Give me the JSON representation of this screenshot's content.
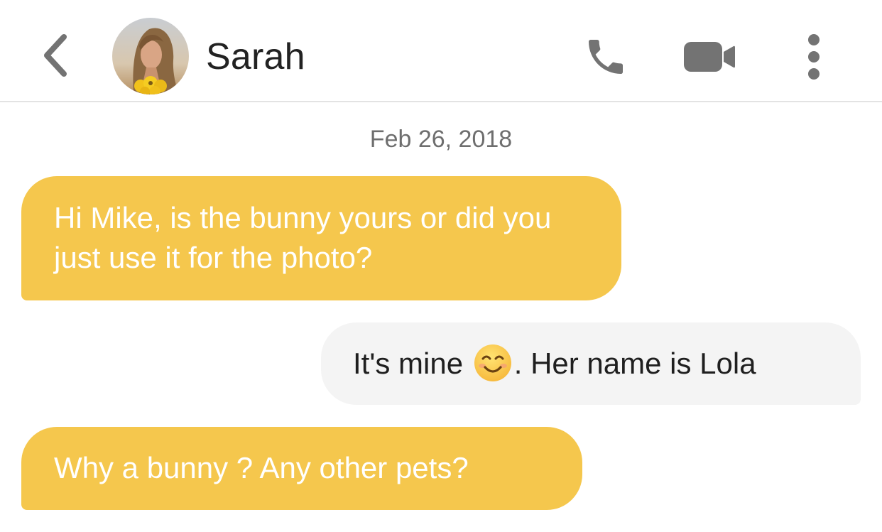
{
  "header": {
    "contact_name": "Sarah",
    "back_icon": "chevron-left-icon",
    "call_icon": "phone-icon",
    "video_icon": "video-camera-icon",
    "more_icon": "more-vertical-icon"
  },
  "conversation": {
    "date": "Feb 26, 2018",
    "messages": [
      {
        "sender": "Sarah",
        "direction": "incoming",
        "text": "Hi Mike, is the bunny yours or did you just use it for the photo?"
      },
      {
        "sender": "Mike",
        "direction": "outgoing",
        "text_before_emoji": "It's mine ",
        "emoji": "smiling-face-icon",
        "text_after_emoji": ". Her name is Lola"
      },
      {
        "sender": "Sarah",
        "direction": "incoming",
        "text": "Why a bunny ? Any other pets?"
      }
    ]
  },
  "colors": {
    "incoming_bubble": "#f5c74d",
    "outgoing_bubble": "#f4f4f4",
    "icon_gray": "#737373"
  }
}
